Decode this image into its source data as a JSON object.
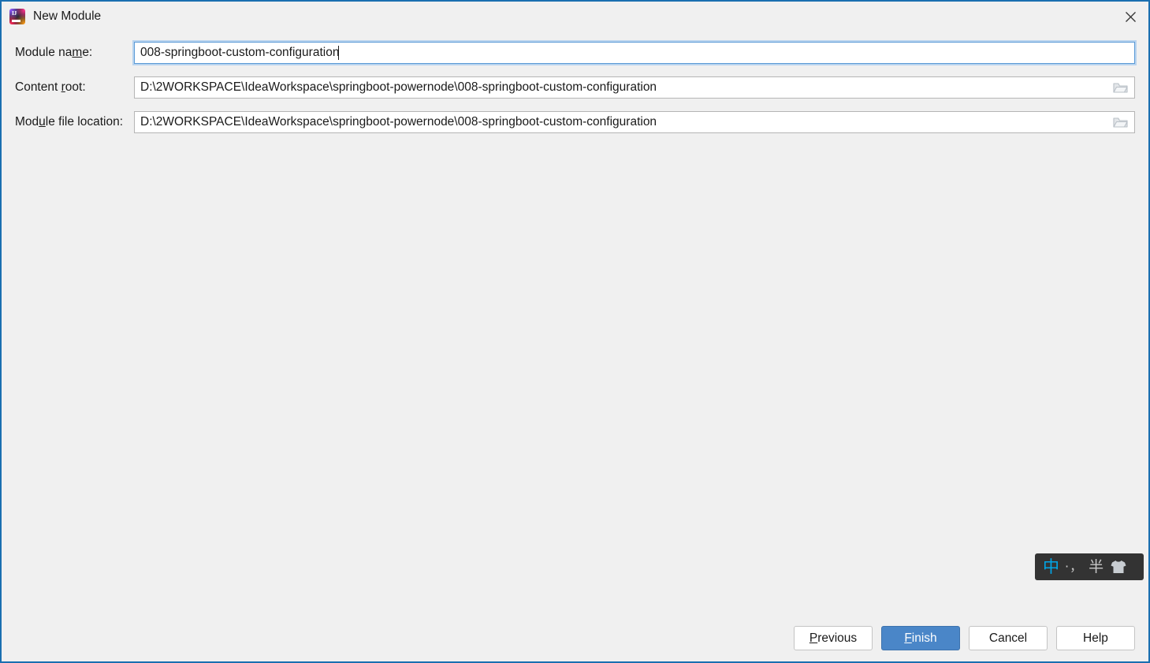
{
  "window": {
    "title": "New Module",
    "app_icon": "intellij-idea-icon",
    "icon_text": "IJ",
    "close_icon": "close-icon",
    "border_color": "#1a6fb0",
    "background_color": "#f0f0f0"
  },
  "form": {
    "rows": [
      {
        "label_before": "Module na",
        "label_mnemonic": "m",
        "label_after": "e:",
        "value": "008-springboot-custom-configuration",
        "focused": true,
        "has_browse": false
      },
      {
        "label_before": "Content ",
        "label_mnemonic": "r",
        "label_after": "oot:",
        "value": "D:\\2WORKSPACE\\IdeaWorkspace\\springboot-powernode\\008-springboot-custom-configuration",
        "focused": false,
        "has_browse": true,
        "browse_icon": "folder-icon"
      },
      {
        "label_before": "Mod",
        "label_mnemonic": "u",
        "label_after": "le file location:",
        "value": "D:\\2WORKSPACE\\IdeaWorkspace\\springboot-powernode\\008-springboot-custom-configuration",
        "focused": false,
        "has_browse": true,
        "browse_icon": "folder-icon"
      }
    ]
  },
  "ime": {
    "mode": "中",
    "mode_color": "#00a7ea",
    "punctuation": "·，",
    "width_mode": "半",
    "skin_icon": "tshirt-icon",
    "background_color": "#333333"
  },
  "footer": {
    "buttons": [
      {
        "before": "",
        "mnemonic": "P",
        "after": "revious",
        "primary": false
      },
      {
        "before": "",
        "mnemonic": "F",
        "after": "inish",
        "primary": true
      },
      {
        "before": "Cancel",
        "mnemonic": "",
        "after": "",
        "primary": false
      },
      {
        "before": "Help",
        "mnemonic": "",
        "after": "",
        "primary": false
      }
    ],
    "primary_color": "#4a86c8"
  }
}
